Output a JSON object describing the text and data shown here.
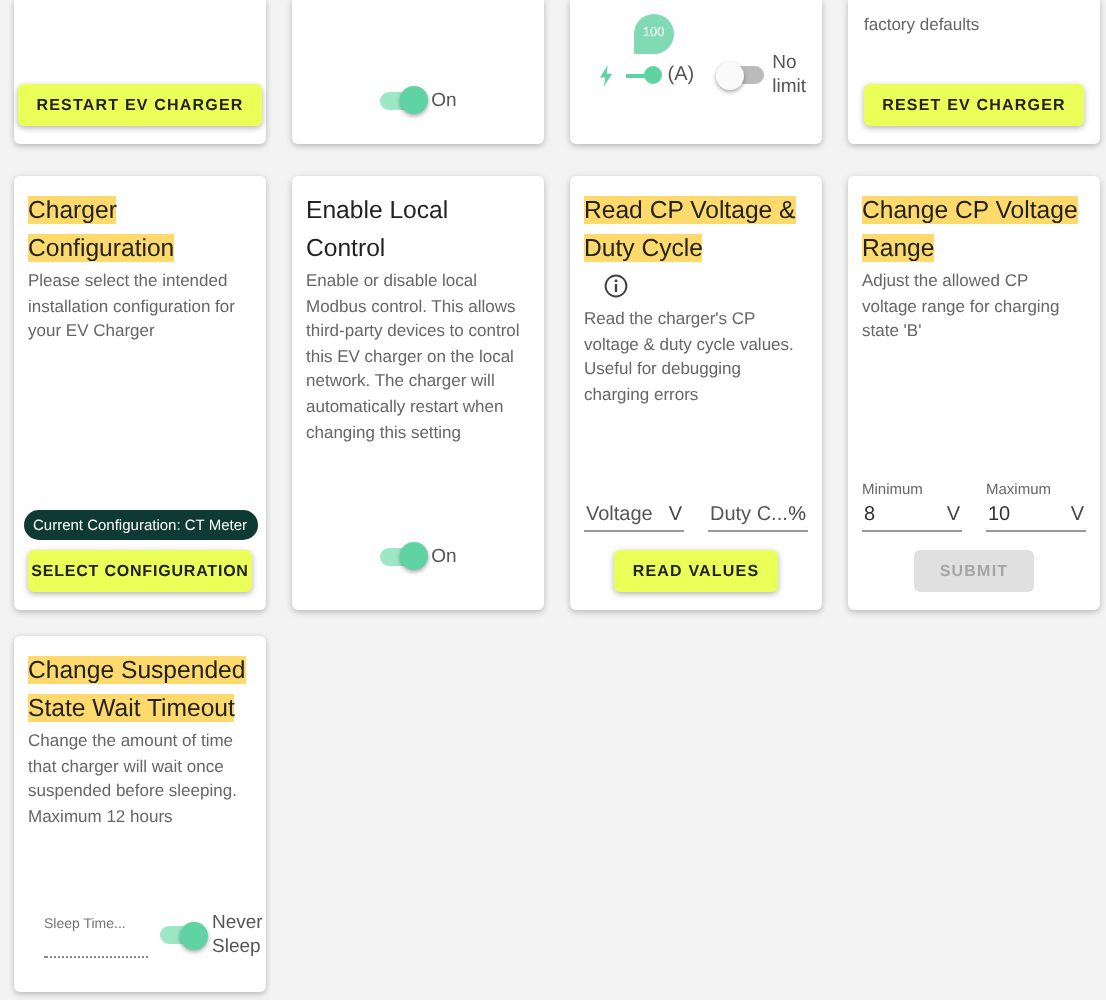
{
  "top_cards": [
    {
      "kind": "button",
      "button": "RESTART EV CHARGER"
    },
    {
      "kind": "toggle",
      "toggle": {
        "label": "On",
        "on": true
      }
    },
    {
      "kind": "slider",
      "bubble": "100",
      "level": 1,
      "unit": "(A)",
      "toggle": {
        "label": "No limit",
        "on": false
      }
    },
    {
      "kind": "text_button",
      "text": "factory defaults",
      "button": "RESET EV CHARGER"
    }
  ],
  "cards": [
    {
      "kind": "config",
      "title": "Charger Configuration",
      "highlighted": true,
      "description": "Please select the intended installation configuration for your EV Charger",
      "chip": "Current Configuration: CT Meter",
      "button": "SELECT CONFIGURATION"
    },
    {
      "kind": "toggle",
      "title": "Enable Local Control",
      "highlighted": false,
      "description": "Enable or disable local Modbus control. This allows third-party devices to control this EV charger on the local network. The charger will automatically restart when changing this setting",
      "toggle": {
        "label": "On",
        "on": true
      }
    },
    {
      "kind": "read",
      "title": "Read CP Voltage & Duty Cycle",
      "highlighted": true,
      "info": true,
      "description": "Read the charger's CP voltage & duty cycle values. Useful for debugging charging errors",
      "fields": [
        {
          "placeholder": "Voltage",
          "suffix": "V"
        },
        {
          "placeholder": "Duty C...",
          "suffix": "%"
        }
      ],
      "button": "READ VALUES"
    },
    {
      "kind": "range",
      "title": "Change CP Voltage Range",
      "highlighted": true,
      "description": "Adjust the allowed CP voltage range for charging state 'B'",
      "fields": [
        {
          "label": "Minimum",
          "value": "8",
          "suffix": "V"
        },
        {
          "label": "Maximum",
          "value": "10",
          "suffix": "V"
        }
      ],
      "button": "SUBMIT",
      "disabled": true
    },
    {
      "kind": "sleep",
      "title": "Change Suspended State Wait Timeout",
      "highlighted": true,
      "description": "Change the amount of time that charger will wait once suspended before sleeping. Maximum 12 hours",
      "field": {
        "placeholder": "Sleep Time..."
      },
      "toggle": {
        "label": "Never Sleep",
        "on": true
      }
    }
  ]
}
